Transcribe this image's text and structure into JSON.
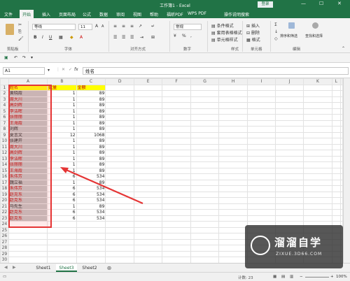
{
  "window": {
    "title": "工作簿1 - Excel",
    "login": "登录"
  },
  "ribbon_tabs": [
    "文件",
    "开始",
    "插入",
    "页面布局",
    "公式",
    "数据",
    "审阅",
    "视图",
    "帮助",
    "福昕PDF",
    "WPS PDF",
    "操作说明搜索"
  ],
  "ribbon": {
    "font_name": "等线",
    "font_size": "11",
    "number_format": "常规",
    "groups": [
      "剪贴板",
      "字体",
      "对齐方式",
      "数字",
      "样式",
      "单元格",
      "编辑"
    ],
    "styles": [
      "条件格式",
      "套用表格格式",
      "单元格样式"
    ],
    "cells": [
      "插入",
      "删除",
      "格式"
    ],
    "edit": [
      "排序和筛选",
      "查找和选择"
    ]
  },
  "formula_bar": {
    "name_box": "A1",
    "fx": "fx",
    "value": "姓名"
  },
  "columns": [
    "A",
    "B",
    "C",
    "D",
    "E",
    "F",
    "G",
    "H",
    "I",
    "J",
    "K",
    "L"
  ],
  "rows": [
    {
      "n": "1",
      "a": "姓名",
      "b": "数量",
      "c": "金额"
    },
    {
      "n": "2",
      "a": "黄晓霞",
      "b": "1",
      "c": "89"
    },
    {
      "n": "3",
      "a": "周大川",
      "b": "1",
      "c": "89"
    },
    {
      "n": "4",
      "a": "高剑辉",
      "b": "1",
      "c": "89"
    },
    {
      "n": "5",
      "a": "李洁晖",
      "b": "1",
      "c": "89"
    },
    {
      "n": "6",
      "a": "张丽丽",
      "b": "1",
      "c": "89"
    },
    {
      "n": "7",
      "a": "王海霞",
      "b": "1",
      "c": "89"
    },
    {
      "n": "8",
      "a": "刘辉",
      "b": "1",
      "c": "89"
    },
    {
      "n": "9",
      "a": "夏言文",
      "b": "12",
      "c": "1068"
    },
    {
      "n": "10",
      "a": "张建开",
      "b": "1",
      "c": "89"
    },
    {
      "n": "11",
      "a": "周大川",
      "b": "1",
      "c": "89"
    },
    {
      "n": "12",
      "a": "高剑辉",
      "b": "1",
      "c": "89"
    },
    {
      "n": "13",
      "a": "李洁晖",
      "b": "1",
      "c": "89"
    },
    {
      "n": "14",
      "a": "张丽丽",
      "b": "1",
      "c": "89"
    },
    {
      "n": "15",
      "a": "王海霞",
      "b": "1",
      "c": "89"
    },
    {
      "n": "16",
      "a": "朱伟芳",
      "b": "6",
      "c": "534"
    },
    {
      "n": "17",
      "a": "魏立福",
      "b": "1",
      "c": "89"
    },
    {
      "n": "18",
      "a": "朱伟芳",
      "b": "6",
      "c": "534"
    },
    {
      "n": "19",
      "a": "赵克东",
      "b": "6",
      "c": "534"
    },
    {
      "n": "20",
      "a": "赵克东",
      "b": "6",
      "c": "534"
    },
    {
      "n": "21",
      "a": "马先生",
      "b": "1",
      "c": "89"
    },
    {
      "n": "22",
      "a": "赵克东",
      "b": "6",
      "c": "534"
    },
    {
      "n": "23",
      "a": "赵克东",
      "b": "6",
      "c": "534"
    },
    {
      "n": "24",
      "a": "",
      "b": "",
      "c": ""
    },
    {
      "n": "25",
      "a": "",
      "b": "",
      "c": ""
    },
    {
      "n": "26",
      "a": "",
      "b": "",
      "c": ""
    },
    {
      "n": "27",
      "a": "",
      "b": "",
      "c": ""
    },
    {
      "n": "28",
      "a": "",
      "b": "",
      "c": ""
    },
    {
      "n": "29",
      "a": "",
      "b": "",
      "c": ""
    },
    {
      "n": "30",
      "a": "",
      "b": "",
      "c": ""
    },
    {
      "n": "31",
      "a": "",
      "b": "",
      "c": ""
    }
  ],
  "sheets": [
    "Sheet1",
    "Sheet3",
    "Sheet2"
  ],
  "active_sheet": "Sheet3",
  "status": {
    "count": "计数: 23",
    "zoom": "100%"
  },
  "watermark": {
    "title": "溜溜自学",
    "url": "ZIXUE.3D66.COM"
  },
  "colors": {
    "excel_green": "#217346",
    "highlight_red": "#e53535"
  }
}
